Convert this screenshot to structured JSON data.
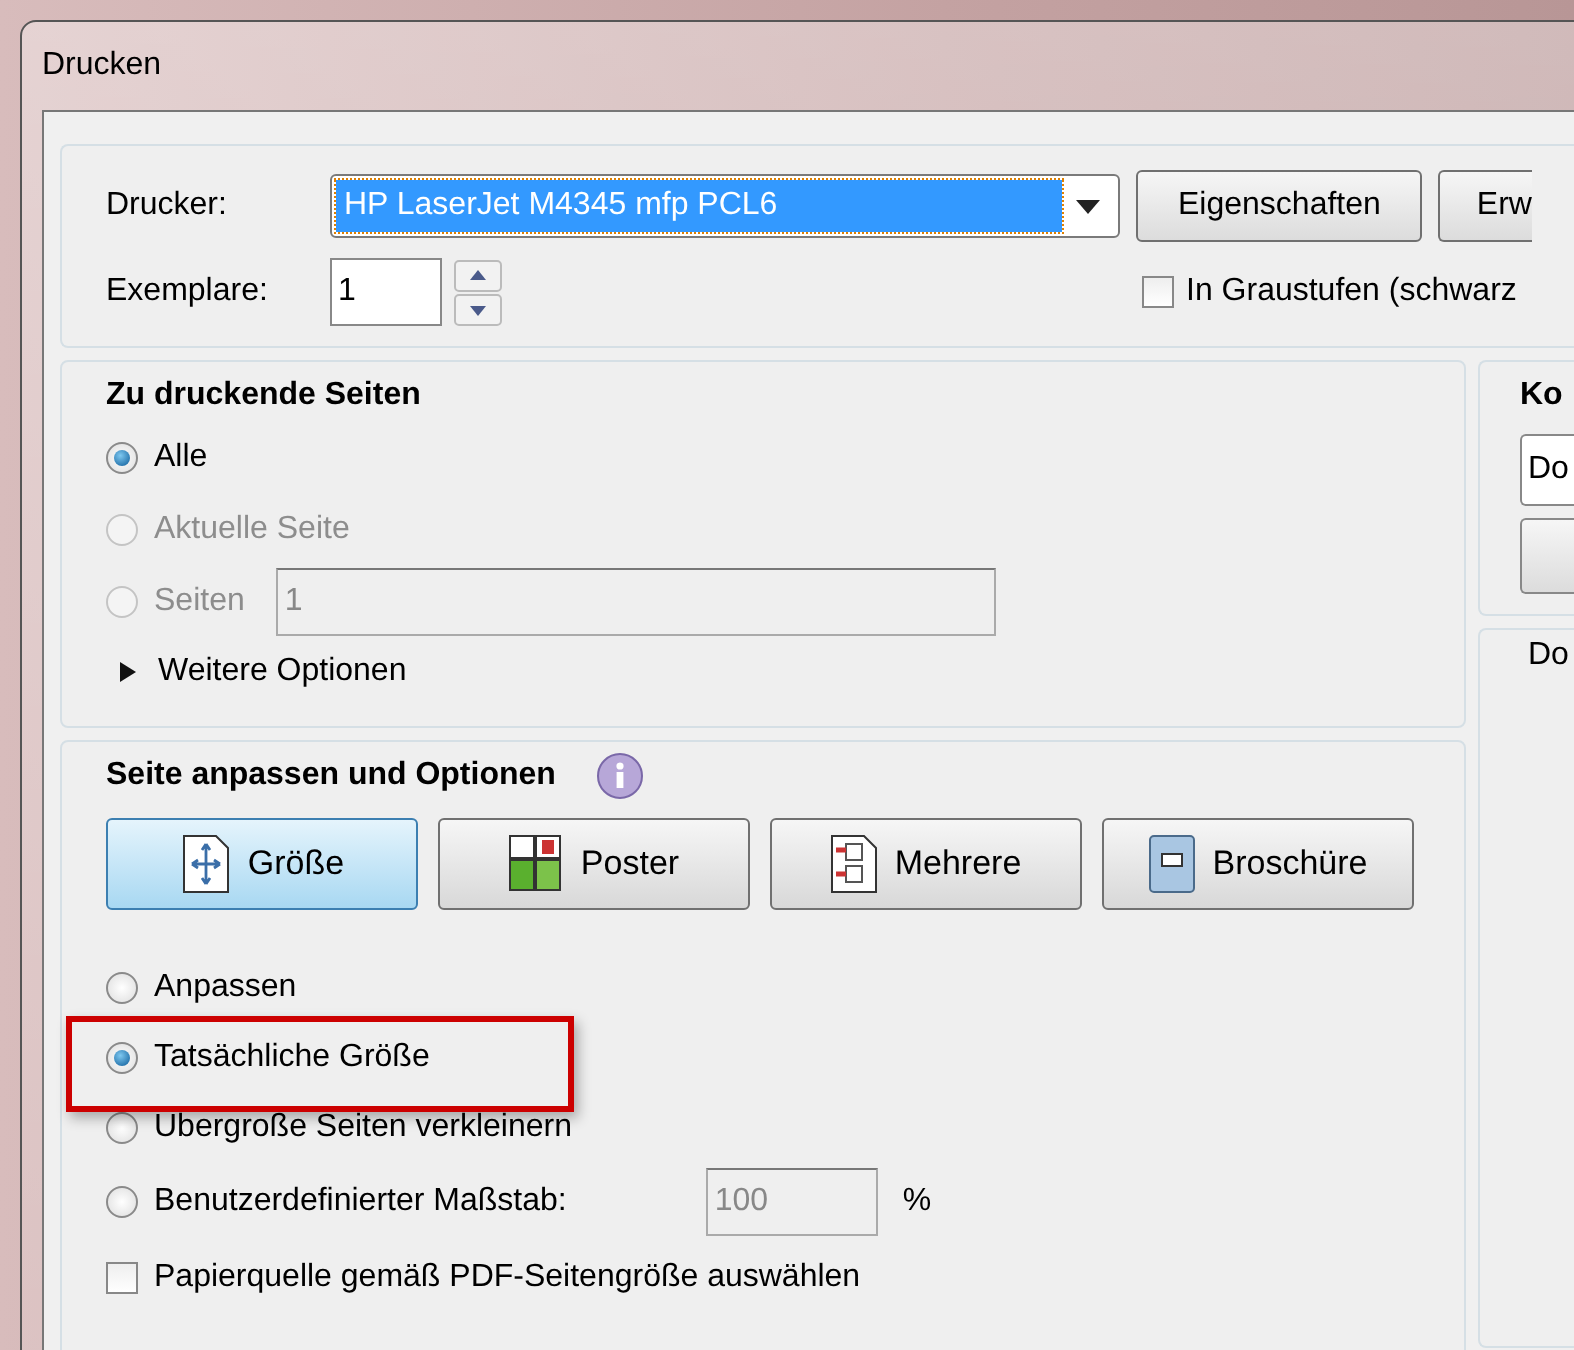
{
  "window": {
    "title": "Drucken"
  },
  "printer": {
    "label": "Drucker:",
    "value": "HP LaserJet M4345 mfp PCL6",
    "buttons": [
      "Eigenschaften",
      "Erw"
    ]
  },
  "copies": {
    "label": "Exemplare:",
    "value": "1"
  },
  "grayscale": {
    "label": "In Graustufen (schwarz",
    "checked": false
  },
  "pages_section": {
    "title": "Zu druckende Seiten",
    "options": [
      {
        "label": "Alle",
        "selected": true,
        "disabled": false
      },
      {
        "label": "Aktuelle Seite",
        "selected": false,
        "disabled": true
      },
      {
        "label": "Seiten",
        "selected": false,
        "disabled": true,
        "field": "1"
      }
    ],
    "more_options": {
      "label": "Weitere Optionen",
      "expanded": false
    }
  },
  "right_panel": {
    "title": "Ko",
    "dropdown": "Do",
    "label": "Do"
  },
  "sizing_section": {
    "title": "Seite anpassen und Optionen",
    "modes": [
      {
        "label": "Größe",
        "kind": "size",
        "selected": true
      },
      {
        "label": "Poster",
        "kind": "poster",
        "selected": false
      },
      {
        "label": "Mehrere",
        "kind": "multiple",
        "selected": false
      },
      {
        "label": "Broschüre",
        "kind": "booklet",
        "selected": false
      }
    ],
    "options": [
      {
        "label": "Anpassen",
        "selected": false,
        "highlighted": false
      },
      {
        "label": "Tatsächliche Größe",
        "selected": true,
        "highlighted": true
      },
      {
        "label": "Übergroße Seiten verkleinern",
        "selected": false,
        "highlighted": false
      },
      {
        "label": "Benutzerdefinierter Maßstab:",
        "selected": false,
        "highlighted": false,
        "field": "100",
        "unit": "%"
      }
    ],
    "paper_source": {
      "label": "Papierquelle gemäß PDF-Seitengröße auswählen",
      "checked": false
    }
  }
}
